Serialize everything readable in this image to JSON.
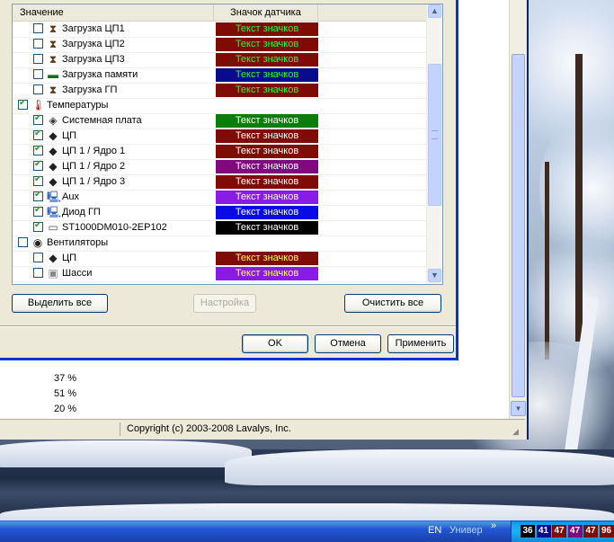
{
  "dialog": {
    "columns": {
      "value": "Значение",
      "badge": "Значок датчика"
    },
    "rows": [
      {
        "label": "Загрузка ЦП1",
        "icon": "hourglass-icon",
        "checked": false,
        "indent": 1,
        "badge": "Текст значков",
        "bg": "#7e0b04",
        "fg": "#22ff22"
      },
      {
        "label": "Загрузка ЦП2",
        "icon": "hourglass-icon",
        "checked": false,
        "indent": 1,
        "badge": "Текст значков",
        "bg": "#7e0b04",
        "fg": "#22ff22"
      },
      {
        "label": "Загрузка ЦП3",
        "icon": "hourglass-icon",
        "checked": false,
        "indent": 1,
        "badge": "Текст значков",
        "bg": "#7e0b04",
        "fg": "#22ff22"
      },
      {
        "label": "Загрузка памяти",
        "icon": "memory-icon",
        "checked": false,
        "indent": 1,
        "badge": "Текст значков",
        "bg": "#0a0a8c",
        "fg": "#22ff22"
      },
      {
        "label": "Загрузка ГП",
        "icon": "hourglass-icon",
        "checked": false,
        "indent": 1,
        "badge": "Текст значков",
        "bg": "#7e0b04",
        "fg": "#22ff22"
      },
      {
        "label": "Температуры",
        "icon": "thermometer-icon",
        "checked": true,
        "indent": 0,
        "badge": "",
        "bg": "",
        "fg": ""
      },
      {
        "label": "Системная плата",
        "icon": "motherboard-icon",
        "checked": true,
        "indent": 1,
        "badge": "Текст значков",
        "bg": "#0a7e0a",
        "fg": "#ffffff"
      },
      {
        "label": "ЦП",
        "icon": "cpu-icon",
        "checked": true,
        "indent": 1,
        "badge": "Текст значков",
        "bg": "#7e0b04",
        "fg": "#ffffff"
      },
      {
        "label": "ЦП 1 / Ядро 1",
        "icon": "cpu-icon",
        "checked": true,
        "indent": 1,
        "badge": "Текст значков",
        "bg": "#7e0b04",
        "fg": "#ffffff"
      },
      {
        "label": "ЦП 1 / Ядро 2",
        "icon": "cpu-icon",
        "checked": true,
        "indent": 1,
        "badge": "Текст значков",
        "bg": "#7e0a7e",
        "fg": "#ffffff"
      },
      {
        "label": "ЦП 1 / Ядро 3",
        "icon": "cpu-icon",
        "checked": true,
        "indent": 1,
        "badge": "Текст значков",
        "bg": "#7e0b04",
        "fg": "#ffffff"
      },
      {
        "label": "Aux",
        "icon": "computer-icon",
        "checked": true,
        "indent": 1,
        "badge": "Текст значков",
        "bg": "#8a1be6",
        "fg": "#ffffff"
      },
      {
        "label": "Диод ГП",
        "icon": "computer-icon",
        "checked": true,
        "indent": 1,
        "badge": "Текст значков",
        "bg": "#0a0ae6",
        "fg": "#ffffff"
      },
      {
        "label": "ST1000DM010-2EP102",
        "icon": "hdd-icon",
        "checked": true,
        "indent": 1,
        "badge": "Текст значков",
        "bg": "#000000",
        "fg": "#ffffff"
      },
      {
        "label": "Вентиляторы",
        "icon": "fan-icon",
        "checked": false,
        "indent": 0,
        "badge": "",
        "bg": "",
        "fg": ""
      },
      {
        "label": "ЦП",
        "icon": "cpu-icon",
        "checked": false,
        "indent": 1,
        "badge": "Текст значков",
        "bg": "#7e0b04",
        "fg": "#ffff44"
      },
      {
        "label": "Шасси",
        "icon": "chassis-icon",
        "checked": false,
        "indent": 1,
        "badge": "Текст значков",
        "bg": "#8a1be6",
        "fg": "#ffff44"
      }
    ],
    "buttons": {
      "select_all": "Выделить все",
      "settings": "Настройка",
      "clear_all": "Очистить все",
      "ok": "OK",
      "cancel": "Отмена",
      "apply": "Применить"
    }
  },
  "background_window": {
    "percents": [
      "37 %",
      "51 %",
      "20 %"
    ],
    "status_text": "Copyright (c) 2003-2008 Lavalys, Inc."
  },
  "taskbar": {
    "lang": "EN",
    "user": "Универ",
    "chevron": "»",
    "tray": [
      {
        "value": "36",
        "bg": "#000000"
      },
      {
        "value": "41",
        "bg": "#0a0a8c"
      },
      {
        "value": "47",
        "bg": "#7e0b04"
      },
      {
        "value": "47",
        "bg": "#7e0a7e"
      },
      {
        "value": "47",
        "bg": "#7e0b04"
      },
      {
        "value": "96",
        "bg": "#7e0b04"
      }
    ]
  }
}
